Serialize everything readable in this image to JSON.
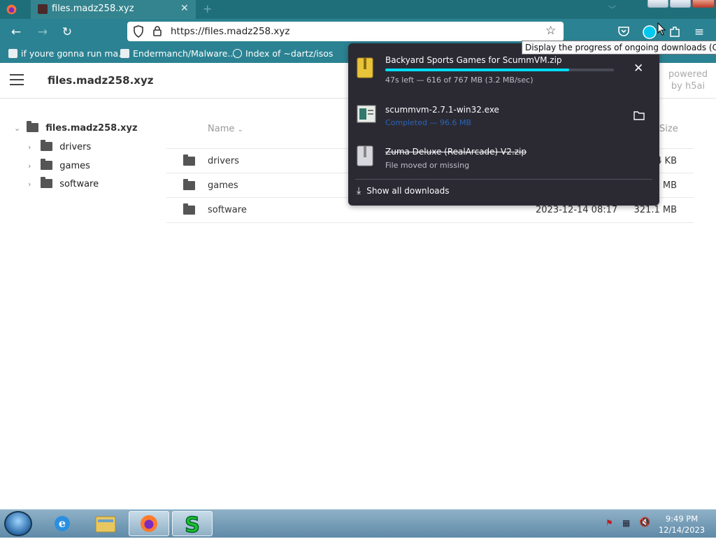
{
  "browser": {
    "tab_title": "files.madz258.xyz",
    "url": "https://files.madz258.xyz",
    "bookmarks": [
      {
        "label": "if youre gonna run ma..."
      },
      {
        "label": "Endermanch/Malware..."
      },
      {
        "label": "Index of ~dartz/isos"
      }
    ],
    "tooltip": "Display the progress of ongoing downloads (Ctrl+J)",
    "accent": "#2b8292"
  },
  "page": {
    "site_name": "files.madz258.xyz",
    "powered_by": "powered by h5ai",
    "tree": {
      "root": "files.madz258.xyz",
      "children": [
        "drivers",
        "games",
        "software"
      ]
    },
    "list": {
      "headers": {
        "name": "Name",
        "size": "Size"
      },
      "rows": [
        {
          "name": "drivers",
          "date": "",
          "size": "4 KB"
        },
        {
          "name": "games",
          "date": "",
          "size": "MB"
        },
        {
          "name": "software",
          "date": "2023-12-14 08:17",
          "size": "321.1 MB"
        }
      ]
    }
  },
  "downloads": {
    "items": [
      {
        "name": "Backyard Sports Games for ScummVM.zip",
        "status": "47s left — 616 of 767 MB (3.2 MB/sec)",
        "progress": 0.803,
        "icon": "zip-icon"
      },
      {
        "name": "scummvm-2.7.1-win32.exe",
        "status": "Completed — 96.6 MB",
        "icon": "exe-icon"
      },
      {
        "name": "Zuma Deluxe (RealArcade) V2.zip",
        "status": "File moved or missing",
        "icon": "zip-icon"
      }
    ],
    "show_all": "Show all downloads"
  },
  "taskbar": {
    "time": "9:49 PM",
    "date": "12/14/2023",
    "apps": [
      "ie-icon",
      "explorer-icon",
      "firefox-icon",
      "s-app-icon"
    ]
  }
}
